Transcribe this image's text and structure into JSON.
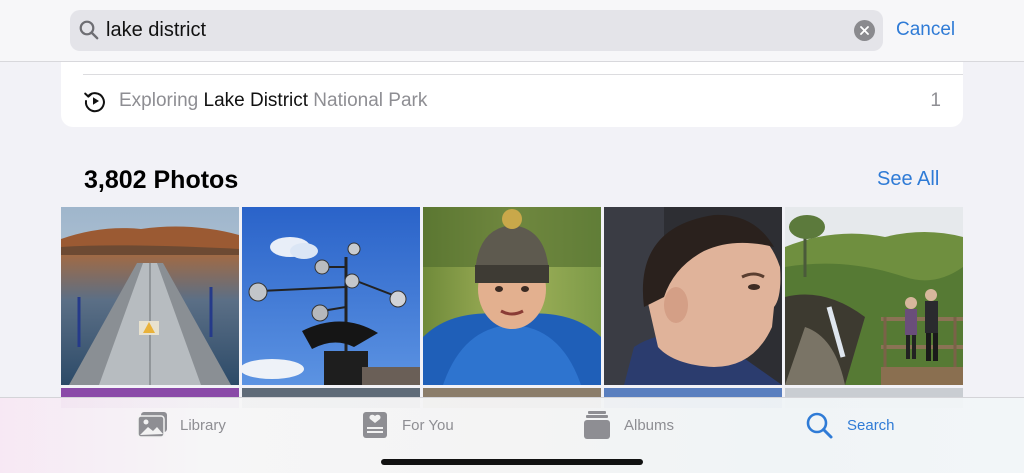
{
  "search": {
    "query": "lake district",
    "cancel_label": "Cancel"
  },
  "suggestion": {
    "prefix": "Exploring ",
    "highlight": "Lake District",
    "suffix": " National Park",
    "count": "1"
  },
  "photos": {
    "title": "3,802 Photos",
    "see_all_label": "See All",
    "thumbnails": [
      {
        "icon": "photo-thumbnail"
      },
      {
        "icon": "photo-thumbnail"
      },
      {
        "icon": "photo-thumbnail"
      },
      {
        "icon": "photo-thumbnail"
      },
      {
        "icon": "photo-thumbnail"
      }
    ]
  },
  "tab_bar": {
    "tabs": [
      {
        "label": "Library",
        "icon": "library-icon",
        "active": false
      },
      {
        "label": "For You",
        "icon": "for-you-icon",
        "active": false
      },
      {
        "label": "Albums",
        "icon": "albums-icon",
        "active": false
      },
      {
        "label": "Search",
        "icon": "search-icon",
        "active": true
      }
    ]
  },
  "colors": {
    "accent": "#2f7bd6",
    "secondary_text": "#8e8e93",
    "background": "#f2f2f7"
  }
}
